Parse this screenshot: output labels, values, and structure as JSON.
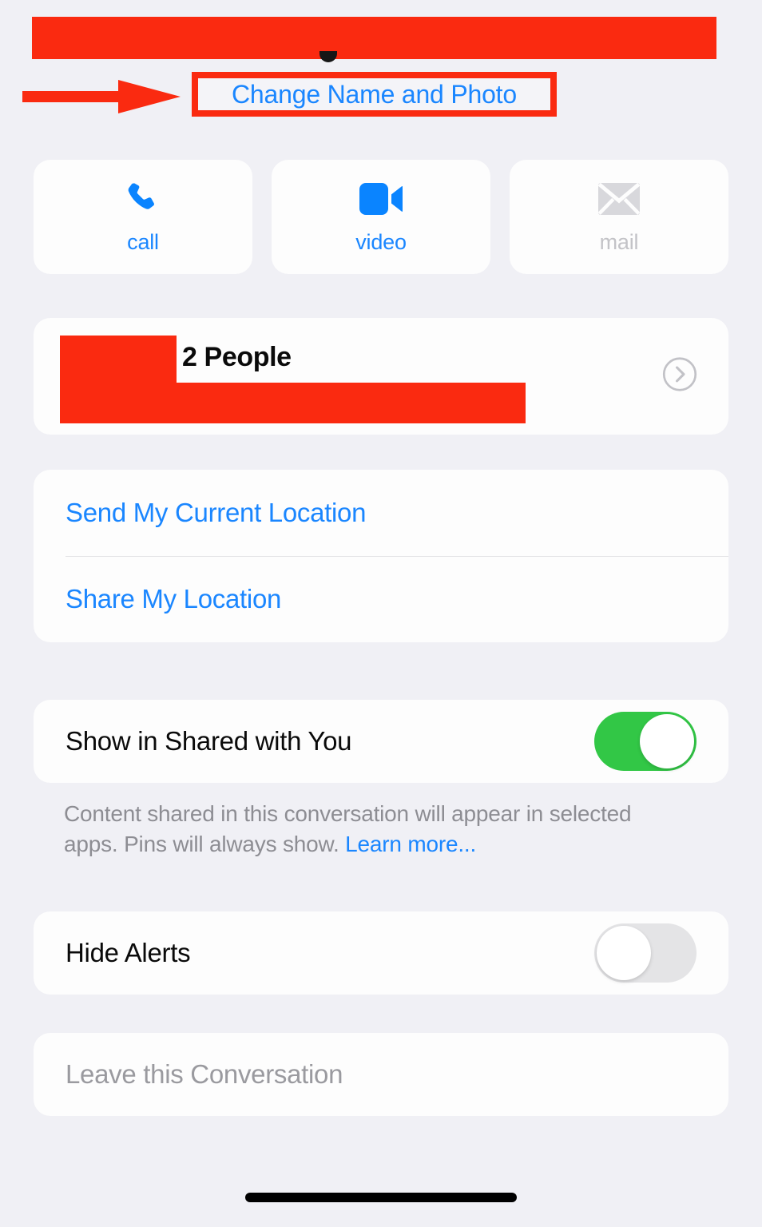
{
  "header": {
    "redacted_title": "",
    "change_name_label": "Change Name and Photo",
    "annotation_color": "#fa2a10",
    "link_color": "#1a86ff"
  },
  "actions": [
    {
      "label": "call",
      "icon": "phone-icon",
      "enabled": true
    },
    {
      "label": "video",
      "icon": "video-camera-icon",
      "enabled": true
    },
    {
      "label": "mail",
      "icon": "envelope-icon",
      "enabled": false
    }
  ],
  "people": {
    "label": "2 People",
    "chevron": "chevron-right-icon"
  },
  "location": {
    "send_current": "Send My Current Location",
    "share": "Share My Location"
  },
  "shared_with_you": {
    "label": "Show in Shared with You",
    "toggle_state": "on",
    "toggle_on_color": "#32c746",
    "note_text": "Content shared in this conversation will appear in selected apps. Pins will always show. ",
    "note_link": "Learn more..."
  },
  "hide_alerts": {
    "label": "Hide Alerts",
    "toggle_state": "off",
    "toggle_off_color": "#e4e4e6"
  },
  "leave": {
    "label": "Leave this Conversation"
  },
  "system": {
    "background_color": "#f0f0f5",
    "card_color": "#fdfdfd"
  }
}
